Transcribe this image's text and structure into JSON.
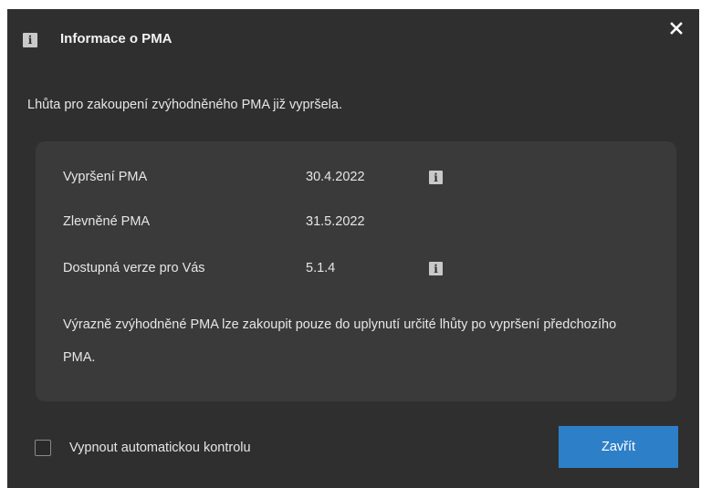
{
  "dialog": {
    "title": "Informace o PMA",
    "title_icon": "info-icon",
    "close_icon": "close-icon"
  },
  "message": "Lhůta pro zakoupení zvýhodněného PMA již vypršela.",
  "details": {
    "rows": [
      {
        "label": "Vypršení PMA",
        "value": "30.4.2022",
        "info_icon": "info-icon"
      },
      {
        "label": "Zlevněné PMA",
        "value": "31.5.2022"
      },
      {
        "label": "Dostupná verze pro Vás",
        "value": "5.1.4",
        "info_icon": "info-icon"
      }
    ],
    "note": "Výrazně zvýhodněné PMA lze zakoupit pouze do uplynutí určité lhůty po vypršení předchozího PMA."
  },
  "footer": {
    "checkbox_label": "Vypnout automatickou kontrolu",
    "checkbox_checked": false,
    "close_button_label": "Zavřít"
  },
  "colors": {
    "dialog_bg": "#2f2f2f",
    "panel_bg": "#3a3a3a",
    "accent_button": "#2d7fc7"
  }
}
